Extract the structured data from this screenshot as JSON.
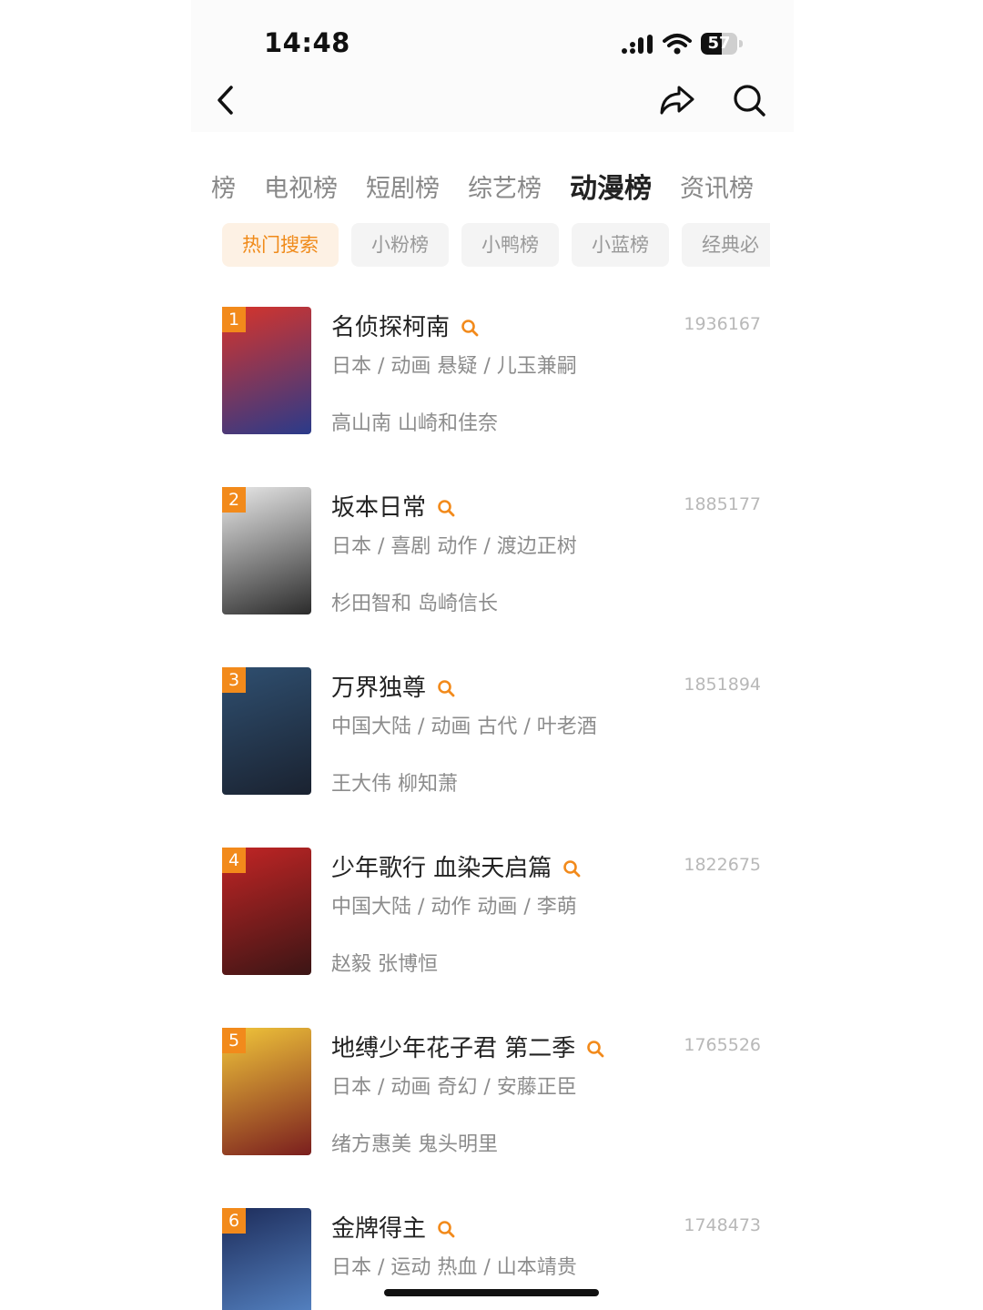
{
  "status": {
    "time": "14:48",
    "battery": "57",
    "battery_level": 0.57
  },
  "tabs": [
    {
      "label": "榜",
      "active": false
    },
    {
      "label": "电视榜",
      "active": false
    },
    {
      "label": "短剧榜",
      "active": false
    },
    {
      "label": "综艺榜",
      "active": false
    },
    {
      "label": "动漫榜",
      "active": true
    },
    {
      "label": "资讯榜",
      "active": false
    }
  ],
  "chips": [
    {
      "label": "热门搜索",
      "active": true
    },
    {
      "label": "小粉榜",
      "active": false
    },
    {
      "label": "小鸭榜",
      "active": false
    },
    {
      "label": "小蓝榜",
      "active": false
    },
    {
      "label": "经典必",
      "active": false
    }
  ],
  "colors": {
    "accent": "#f28a1b",
    "active_chip_bg": "#fdf1e4"
  },
  "items": [
    {
      "rank": "1",
      "title": "名侦探柯南",
      "count": "1936167",
      "meta": "日本 / 动画 悬疑 / 儿玉兼嗣",
      "cast": "高山南 山崎和佳奈",
      "poster_colors": [
        "#d8342a",
        "#2a3a8a"
      ]
    },
    {
      "rank": "2",
      "title": "坂本日常",
      "count": "1885177",
      "meta": "日本 / 喜剧 动作 / 渡边正树",
      "cast": "杉田智和 岛崎信长",
      "poster_colors": [
        "#e9e9e9",
        "#2b2b2b"
      ]
    },
    {
      "rank": "3",
      "title": "万界独尊",
      "count": "1851894",
      "meta": "中国大陆 / 动画 古代 / 叶老酒",
      "cast": "王大伟 柳知萧",
      "poster_colors": [
        "#2f4f70",
        "#1a2230"
      ]
    },
    {
      "rank": "4",
      "title": "少年歌行 血染天启篇",
      "count": "1822675",
      "meta": "中国大陆 / 动作 动画 / 李萌",
      "cast": "赵毅 张博恒",
      "poster_colors": [
        "#c22525",
        "#3b1515"
      ]
    },
    {
      "rank": "5",
      "title": "地缚少年花子君 第二季",
      "count": "1765526",
      "meta": "日本 / 动画 奇幻 / 安藤正臣",
      "cast": "绪方惠美 鬼头明里",
      "poster_colors": [
        "#f1c63a",
        "#7a1e1e"
      ]
    },
    {
      "rank": "6",
      "title": "金牌得主",
      "count": "1748473",
      "meta": "日本 / 运动 热血 / 山本靖贵",
      "cast": "",
      "poster_colors": [
        "#1d2c5a",
        "#5d8fd1"
      ]
    }
  ]
}
